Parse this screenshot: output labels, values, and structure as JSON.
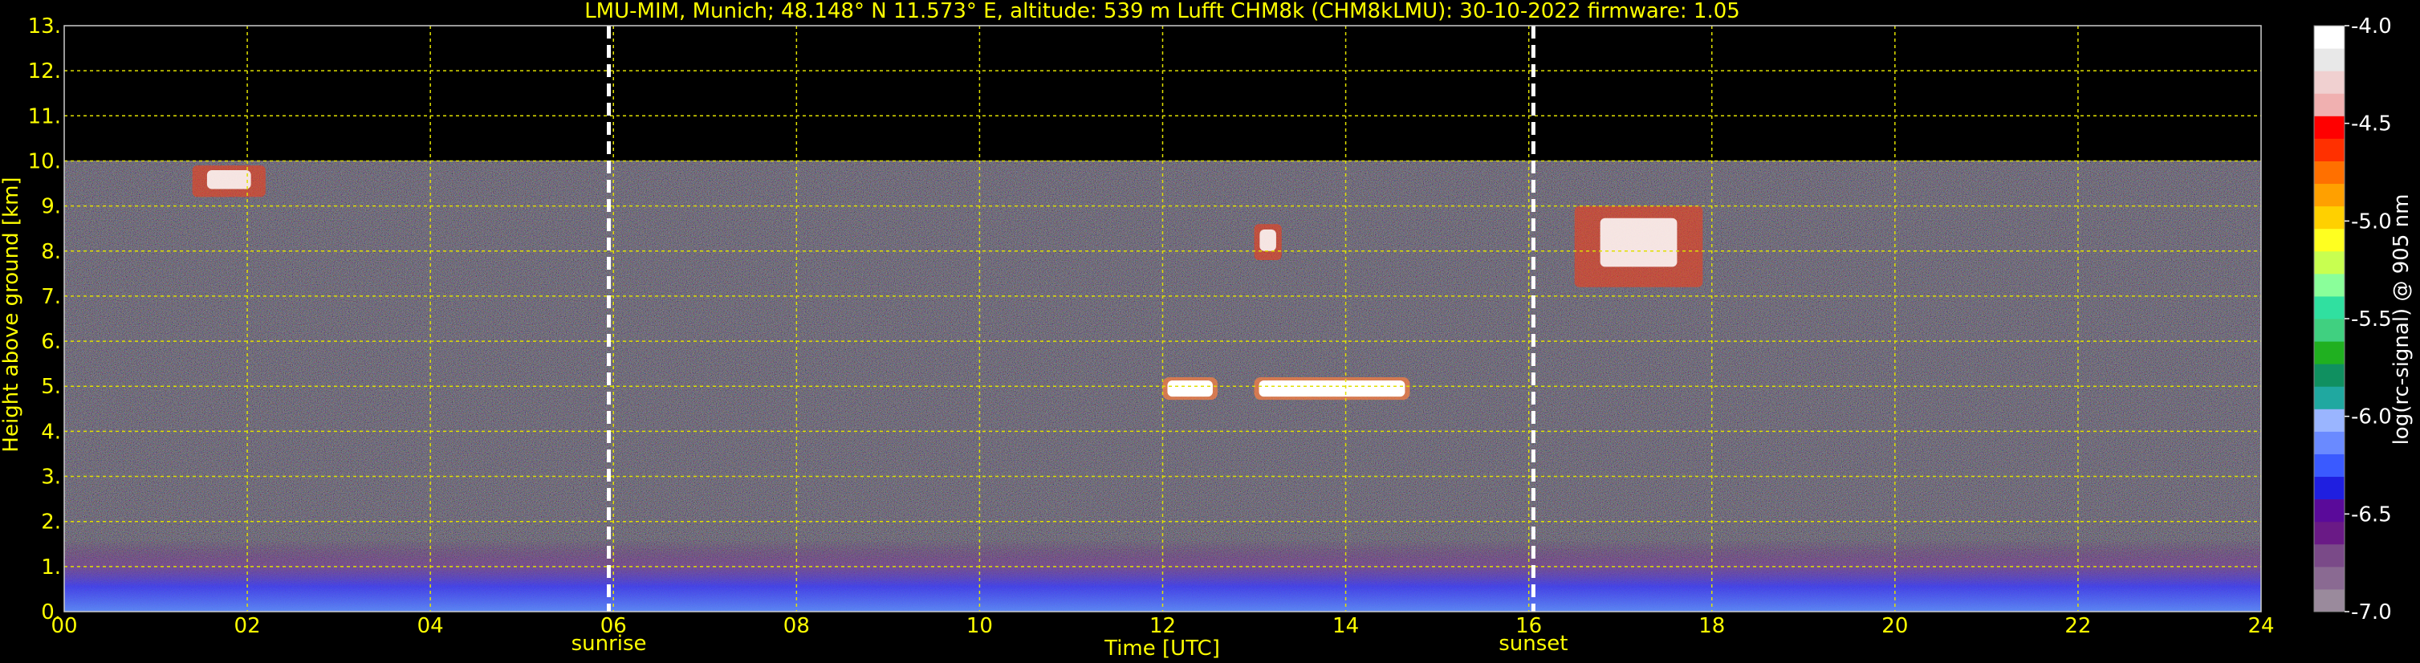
{
  "chart_data": {
    "type": "heatmap",
    "title": "LMU-MIM, Munich; 48.148° N 11.573° E, altitude: 539 m    Lufft CHM8k (CHM8kLMU): 30-10-2022    firmware: 1.05",
    "xlabel": "Time [UTC]",
    "ylabel": "Height above ground [km]",
    "xlim": [
      0,
      24
    ],
    "ylim": [
      0,
      13
    ],
    "x_ticks": [
      "00",
      "02",
      "04",
      "06",
      "08",
      "10",
      "12",
      "14",
      "16",
      "18",
      "20",
      "22",
      "24"
    ],
    "y_ticks": [
      "0.",
      "1.",
      "2.",
      "3.",
      "4.",
      "5.",
      "6.",
      "7.",
      "8.",
      "9.",
      "10.",
      "11.",
      "12.",
      "13."
    ],
    "grid": true,
    "data_max_height_km": 10,
    "events": [
      {
        "label": "sunrise",
        "time": 5.95
      },
      {
        "label": "sunset",
        "time": 16.05
      }
    ],
    "colorbar": {
      "label": "log(rc-signal) @ 905 nm",
      "range": [
        -7.0,
        -4.0
      ],
      "ticks": [
        "-4.0",
        "-4.5",
        "-5.0",
        "-5.5",
        "-6.0",
        "-6.5",
        "-7.0"
      ],
      "colors": [
        "#9a8a9c",
        "#8a6a92",
        "#7a4a88",
        "#6a1a86",
        "#5a0a9a",
        "#1f1fe0",
        "#3a5aff",
        "#6a8aff",
        "#9ab5ff",
        "#20a8a0",
        "#109060",
        "#20b020",
        "#40d080",
        "#30e0a0",
        "#8aff9a",
        "#c8ff50",
        "#ffff20",
        "#ffd000",
        "#ffa000",
        "#ff7000",
        "#ff3000",
        "#ff0000",
        "#f0b0b0",
        "#f0d0d0",
        "#e8e8e8",
        "#ffffff"
      ]
    },
    "features": [
      {
        "kind": "boundary layer",
        "start": 0,
        "end": 24,
        "height_low": 0,
        "height_high": 1.6
      },
      {
        "kind": "cloud",
        "start": 12.0,
        "end": 12.6,
        "height_low": 4.7,
        "height_high": 5.2
      },
      {
        "kind": "cloud",
        "start": 13.0,
        "end": 14.7,
        "height_low": 4.7,
        "height_high": 5.2
      },
      {
        "kind": "cirrus",
        "start": 16.5,
        "end": 17.9,
        "height_low": 7.2,
        "height_high": 9.0
      },
      {
        "kind": "cirrus",
        "start": 13.0,
        "end": 13.3,
        "height_low": 7.8,
        "height_high": 8.6
      },
      {
        "kind": "cirrus",
        "start": 1.4,
        "end": 2.2,
        "height_low": 9.2,
        "height_high": 9.9
      }
    ]
  }
}
